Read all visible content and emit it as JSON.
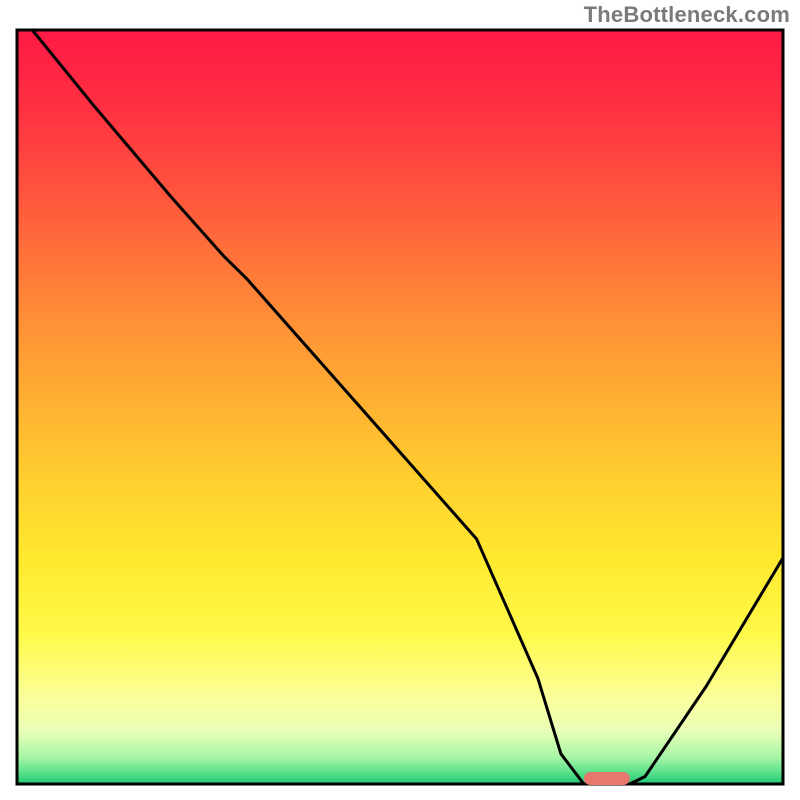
{
  "watermark": "TheBottleneck.com",
  "chart_data": {
    "type": "line",
    "title": "",
    "xlabel": "",
    "ylabel": "",
    "xlim": [
      0,
      100
    ],
    "ylim": [
      0,
      100
    ],
    "x": [
      2,
      10,
      20,
      27,
      30,
      40,
      50,
      60,
      68,
      71,
      74,
      80,
      82,
      90,
      100
    ],
    "values": [
      100,
      90,
      78,
      70,
      67,
      55.5,
      44,
      32.5,
      14,
      4,
      0,
      0,
      1,
      13,
      30
    ],
    "marker": {
      "x_start": 74,
      "x_end": 80,
      "y": 0,
      "color": "#e8786e"
    },
    "gradient_stops": [
      {
        "offset": 0.0,
        "color": "#ff1a46"
      },
      {
        "offset": 0.1,
        "color": "#ff2f42"
      },
      {
        "offset": 0.2,
        "color": "#ff4f3e"
      },
      {
        "offset": 0.3,
        "color": "#ff723a"
      },
      {
        "offset": 0.4,
        "color": "#ff9436"
      },
      {
        "offset": 0.5,
        "color": "#ffb232"
      },
      {
        "offset": 0.6,
        "color": "#ffd02f"
      },
      {
        "offset": 0.7,
        "color": "#ffe82f"
      },
      {
        "offset": 0.8,
        "color": "#fff948"
      },
      {
        "offset": 0.885,
        "color": "#fcff9a"
      },
      {
        "offset": 0.93,
        "color": "#e8ffb8"
      },
      {
        "offset": 0.965,
        "color": "#a6f5a6"
      },
      {
        "offset": 0.985,
        "color": "#5ae08a"
      },
      {
        "offset": 1.0,
        "color": "#20c977"
      }
    ]
  }
}
